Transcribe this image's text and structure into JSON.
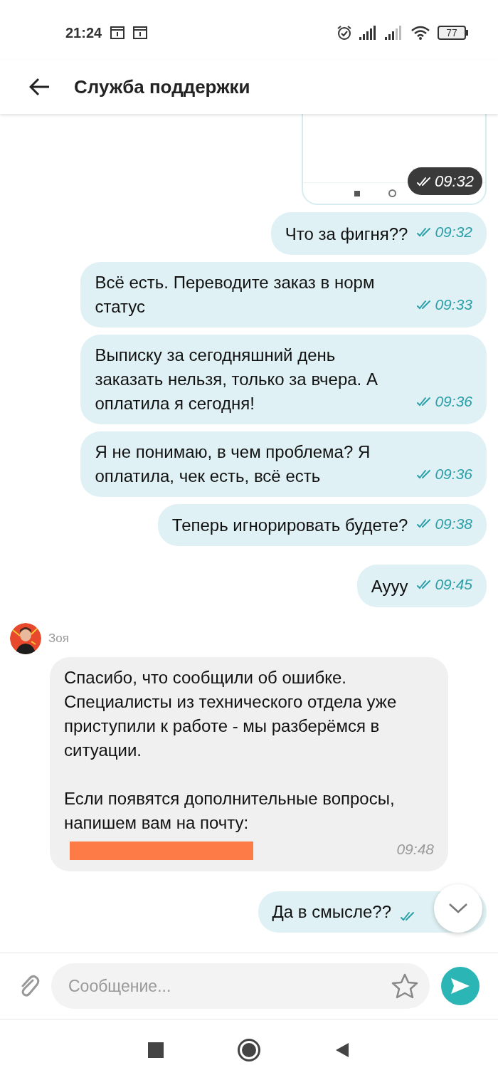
{
  "status_bar": {
    "time": "21:24",
    "battery": "77"
  },
  "header": {
    "title": "Служба поддержки"
  },
  "messages": [
    {
      "time": "09:32",
      "read": true
    },
    {
      "kind": "outgoing",
      "text": "Что за фигня??",
      "time": "09:32",
      "read": true
    },
    {
      "kind": "outgoing",
      "text": "Всё есть. Переводите заказ в норм статус",
      "time": "09:33",
      "read": true
    },
    {
      "kind": "outgoing",
      "text": "Выписку за сегодняшний день заказать нельзя, только за вчера. А оплатила я сегодня!",
      "time": "09:36",
      "read": true
    },
    {
      "kind": "outgoing",
      "text": "Я не понимаю, в чем проблема? Я оплатила, чек есть, всё есть",
      "time": "09:36",
      "read": true
    },
    {
      "kind": "outgoing",
      "text": "Теперь игнорировать будете?",
      "time": "09:38",
      "read": true
    },
    {
      "kind": "outgoing",
      "text": "Аууу",
      "time": "09:45",
      "read": true
    },
    {
      "kind": "incoming",
      "sender": "Зоя",
      "text": "Спасибо, что сообщили об ошибке. Специалисты из технического отдела уже приступили к работе - мы разберёмся в ситуации.\n\nЕсли появятся дополнительные вопросы, напишем вам на почту:",
      "time": "09:48"
    },
    {
      "kind": "outgoing",
      "text": "Да в смысле??",
      "read": true
    }
  ],
  "input": {
    "placeholder": "Сообщение..."
  }
}
